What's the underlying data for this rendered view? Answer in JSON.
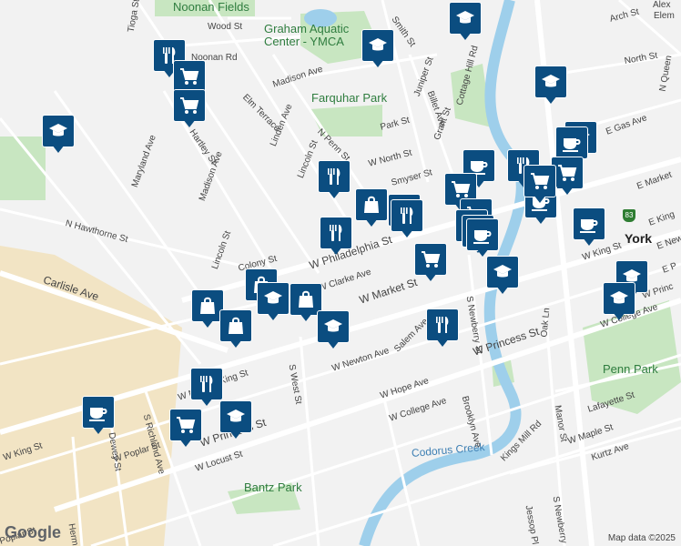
{
  "labels": [
    {
      "text": "Noonan Fields",
      "kind": "park"
    },
    {
      "text": "Graham Aquatic",
      "kind": "park"
    },
    {
      "text": "Center - YMCA",
      "kind": "park"
    },
    {
      "text": "Farquhar Park",
      "kind": "park"
    },
    {
      "text": "Penn Park",
      "kind": "park"
    },
    {
      "text": "Bantz Park",
      "kind": "park"
    },
    {
      "text": "Codorus Creek",
      "kind": "water"
    },
    {
      "text": "York",
      "kind": "city"
    },
    {
      "text": "Alex",
      "kind": "street"
    },
    {
      "text": "Elem",
      "kind": "street"
    },
    {
      "text": "Wood St",
      "kind": "street"
    },
    {
      "text": "Noonan Rd",
      "kind": "street"
    },
    {
      "text": "Madison Ave",
      "kind": "street"
    },
    {
      "text": "Elm Terrace",
      "kind": "street"
    },
    {
      "text": "Linden Ave",
      "kind": "street"
    },
    {
      "text": "N Penn St",
      "kind": "street"
    },
    {
      "text": "Lincoln St",
      "kind": "street"
    },
    {
      "text": "Park St",
      "kind": "street"
    },
    {
      "text": "Grant St",
      "kind": "street"
    },
    {
      "text": "Juniper St",
      "kind": "street"
    },
    {
      "text": "Billet Ave",
      "kind": "street"
    },
    {
      "text": "Cottage Hill Rd",
      "kind": "street"
    },
    {
      "text": "Smith St",
      "kind": "street"
    },
    {
      "text": "Arch St",
      "kind": "street"
    },
    {
      "text": "North St",
      "kind": "street"
    },
    {
      "text": "E Gas Ave",
      "kind": "street"
    },
    {
      "text": "W North St",
      "kind": "street"
    },
    {
      "text": "Smyser St",
      "kind": "street"
    },
    {
      "text": "E Market",
      "kind": "street"
    },
    {
      "text": "E King",
      "kind": "street"
    },
    {
      "text": "E New",
      "kind": "street"
    },
    {
      "text": "E P",
      "kind": "street"
    },
    {
      "text": "N Queen",
      "kind": "street"
    },
    {
      "text": "Tioga St",
      "kind": "street"
    },
    {
      "text": "Maryland Ave",
      "kind": "street"
    },
    {
      "text": "Hartley St",
      "kind": "street"
    },
    {
      "text": "Madison Ave",
      "kind": "street"
    },
    {
      "text": "N Hawthorne St",
      "kind": "street"
    },
    {
      "text": "Carlisle Ave",
      "kind": "street"
    },
    {
      "text": "Lincoln St",
      "kind": "street"
    },
    {
      "text": "Colony St",
      "kind": "street"
    },
    {
      "text": "W Philadelphia St",
      "kind": "street"
    },
    {
      "text": "W Clarke Ave",
      "kind": "street"
    },
    {
      "text": "W Market St",
      "kind": "street"
    },
    {
      "text": "W King St",
      "kind": "street"
    },
    {
      "text": "W Princess St",
      "kind": "street"
    },
    {
      "text": "W Newton Ave",
      "kind": "street"
    },
    {
      "text": "Salem Ave",
      "kind": "street"
    },
    {
      "text": "W Hope Ave",
      "kind": "street"
    },
    {
      "text": "W College Ave",
      "kind": "street"
    },
    {
      "text": "W College Ave",
      "kind": "street"
    },
    {
      "text": "S Newberry St",
      "kind": "street"
    },
    {
      "text": "Brooklyn Ave",
      "kind": "street"
    },
    {
      "text": "Oak Ln",
      "kind": "street"
    },
    {
      "text": "Manor St",
      "kind": "street"
    },
    {
      "text": "Lafayette St",
      "kind": "street"
    },
    {
      "text": "W Maple St",
      "kind": "street"
    },
    {
      "text": "Kurtz Ave",
      "kind": "street"
    },
    {
      "text": "Kings Mill Rd",
      "kind": "street"
    },
    {
      "text": "S Newberry St",
      "kind": "street"
    },
    {
      "text": "Jessop Pl",
      "kind": "street"
    },
    {
      "text": "S West St",
      "kind": "street"
    },
    {
      "text": "S Richland Ave",
      "kind": "street"
    },
    {
      "text": "Dewey St",
      "kind": "street"
    },
    {
      "text": "W Poplar St",
      "kind": "street"
    },
    {
      "text": "W Locust St",
      "kind": "street"
    },
    {
      "text": "Poplar St",
      "kind": "street"
    },
    {
      "text": "Herman St",
      "kind": "street"
    },
    {
      "text": "W King St",
      "kind": "street"
    },
    {
      "text": "W Princess St",
      "kind": "street"
    },
    {
      "text": "W Ma",
      "kind": "street"
    },
    {
      "text": "W Princ",
      "kind": "street"
    },
    {
      "text": "W King St",
      "kind": "street"
    }
  ],
  "markers": [
    {
      "icon": "school-icon"
    },
    {
      "icon": "school-icon"
    },
    {
      "icon": "restaurant-icon"
    },
    {
      "icon": "grocery-icon"
    },
    {
      "icon": "grocery-icon"
    },
    {
      "icon": "school-icon"
    },
    {
      "icon": "school-icon"
    },
    {
      "icon": "school-icon"
    },
    {
      "icon": "cafe-icon"
    },
    {
      "icon": "restaurant-icon"
    },
    {
      "icon": "grocery-icon"
    },
    {
      "icon": "cafe-icon"
    },
    {
      "icon": "restaurant-icon"
    },
    {
      "icon": "restaurant-icon"
    },
    {
      "icon": "grocery-icon"
    },
    {
      "icon": "cafe-icon"
    },
    {
      "icon": "grocery-icon"
    },
    {
      "icon": "shopping-icon"
    },
    {
      "icon": "restaurant-icon"
    },
    {
      "icon": "restaurant-icon"
    },
    {
      "icon": "grocery-icon"
    },
    {
      "icon": "grocery-icon"
    },
    {
      "icon": "cafe-icon"
    },
    {
      "icon": "cafe-icon"
    },
    {
      "icon": "cafe-icon"
    },
    {
      "icon": "school-icon"
    },
    {
      "icon": "school-icon"
    },
    {
      "icon": "school-icon"
    },
    {
      "icon": "shopping-icon"
    },
    {
      "icon": "shopping-icon"
    },
    {
      "icon": "grocery-icon"
    },
    {
      "icon": "school-icon"
    },
    {
      "icon": "shopping-icon"
    },
    {
      "icon": "shopping-icon"
    },
    {
      "icon": "school-icon"
    },
    {
      "icon": "restaurant-icon"
    },
    {
      "icon": "restaurant-icon"
    },
    {
      "icon": "grocery-icon"
    },
    {
      "icon": "school-icon"
    },
    {
      "icon": "cafe-icon"
    }
  ],
  "branding": {
    "logo": "Google",
    "attribution": "Map data ©2025"
  },
  "route_shield": "83",
  "colors": {
    "marker": "#0b4d80",
    "park": "#c8e6c1",
    "water": "#9ecfeb",
    "road": "#ffffff",
    "background": "#f2f2f2"
  }
}
